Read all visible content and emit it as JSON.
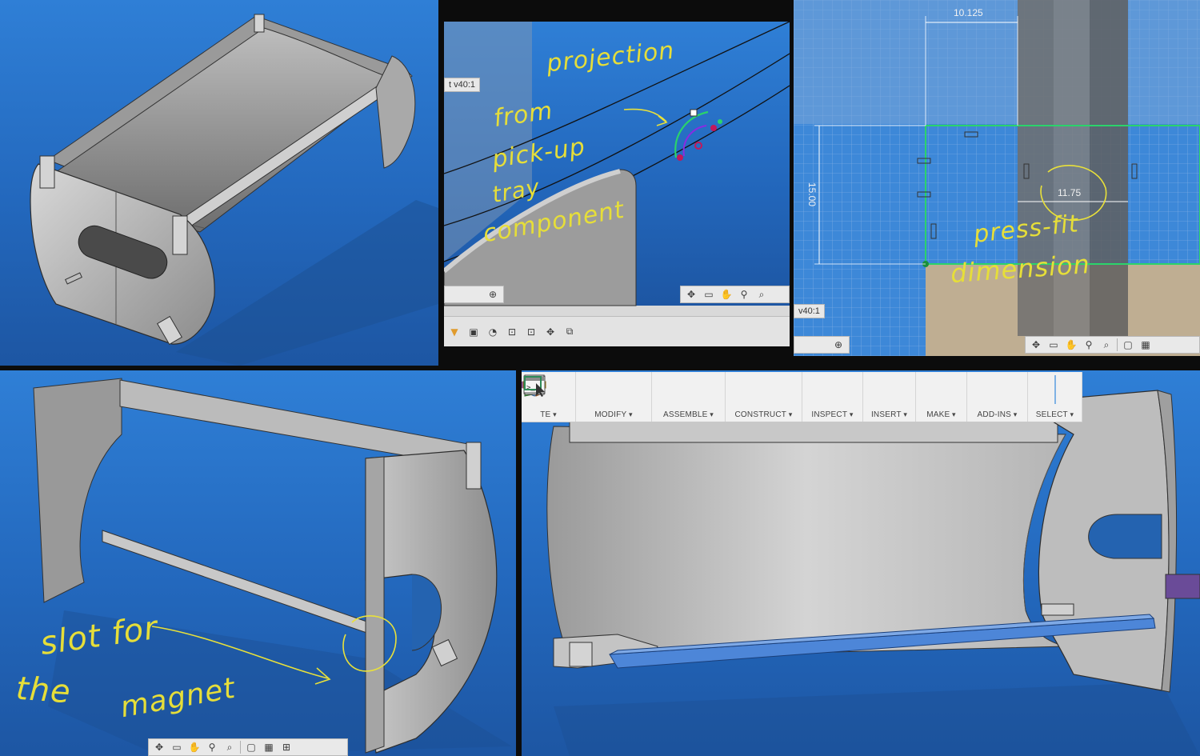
{
  "panels": {
    "top_left": {},
    "top_center": {
      "version_label": "t v40:1",
      "annotation": [
        "projection",
        "from",
        "pick-up",
        "tray",
        "component"
      ]
    },
    "top_right": {
      "version_label": "v40:1",
      "dimensions": {
        "width_top": "10.125",
        "height_left": "15.00",
        "width_mid": "11.75"
      },
      "annotation": [
        "press-fit",
        "dimension"
      ]
    },
    "bottom_left": {
      "annotation": [
        "slot for",
        "the",
        "magnet"
      ]
    },
    "bottom_right": {
      "toolbar": {
        "groups": [
          {
            "label": "TE",
            "icons": [
              "sketch-icon",
              "revolve-icon"
            ]
          },
          {
            "label": "MODIFY",
            "icons": [
              "press-pull-icon",
              "sigma-icon"
            ]
          },
          {
            "label": "ASSEMBLE",
            "icons": [
              "new-component-icon",
              "joint-icon"
            ]
          },
          {
            "label": "CONSTRUCT",
            "icons": [
              "plane-icon"
            ]
          },
          {
            "label": "INSPECT",
            "icons": [
              "measure-icon"
            ]
          },
          {
            "label": "INSERT",
            "icons": [
              "insert-image-icon"
            ]
          },
          {
            "label": "MAKE",
            "icons": [
              "3d-print-icon"
            ]
          },
          {
            "label": "ADD-INS",
            "icons": [
              "scripts-icon"
            ]
          },
          {
            "label": "SELECT",
            "icons": [
              "select-icon"
            ]
          }
        ]
      }
    }
  },
  "colors": {
    "viewport_blue": "#2a72c8",
    "annotation_yellow": "#e6de39",
    "sketch_green": "#2bd36b"
  }
}
